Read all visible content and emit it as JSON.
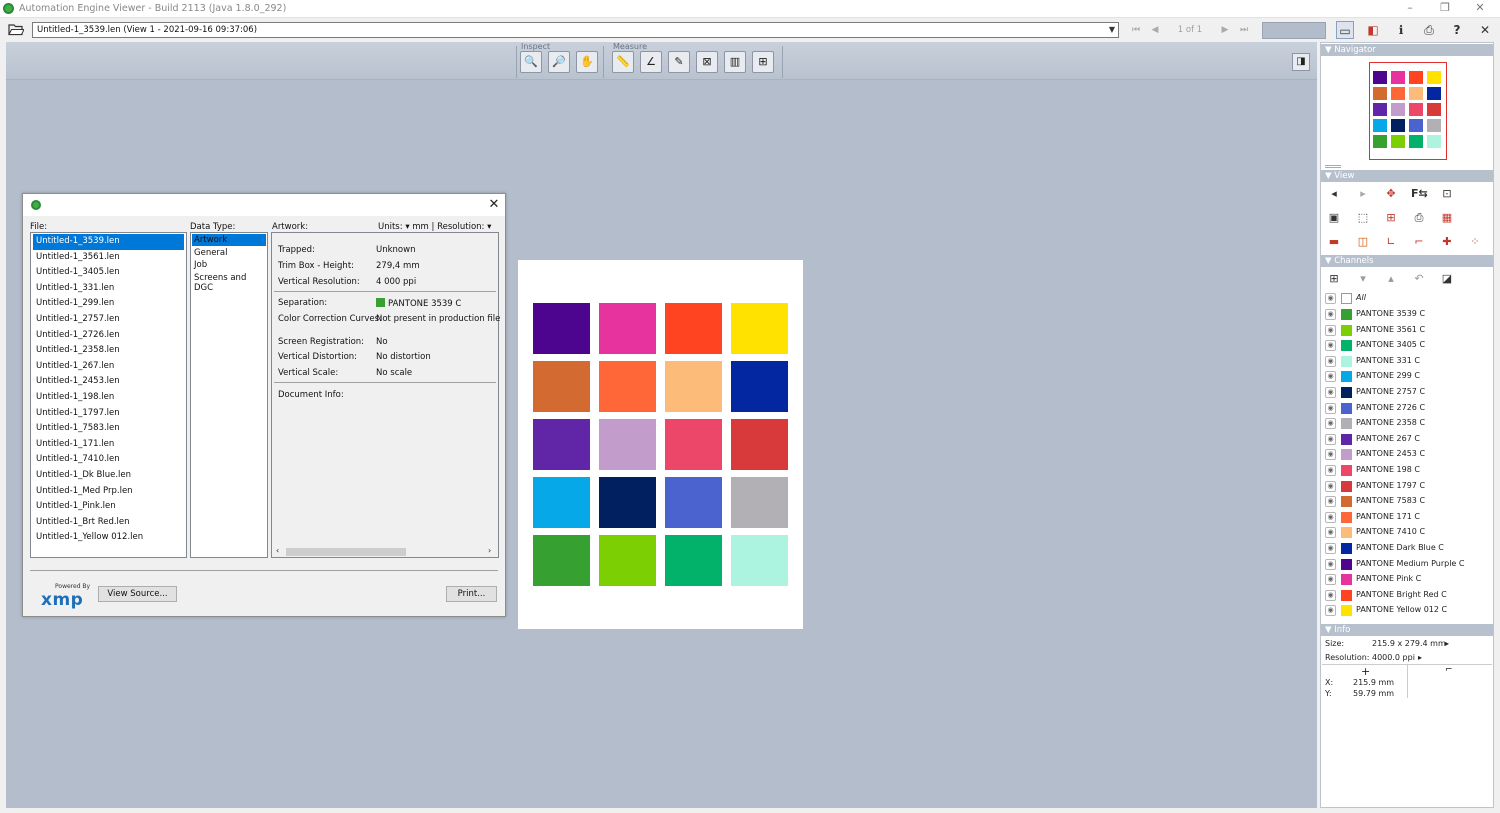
{
  "window": {
    "title": "Automation Engine Viewer - Build 2113 (Java 1.8.0_292)",
    "min": "–",
    "max": "❐",
    "close": "✕"
  },
  "toolbar": {
    "document": "Untitled-1_3539.len (View 1 - 2021-09-16 09:37:06)",
    "page_of": "1 of 1"
  },
  "ribbon": {
    "inspect_label": "Inspect",
    "measure_label": "Measure"
  },
  "dialog": {
    "file_label": "File:",
    "datatype_label": "Data Type:",
    "artwork_label": "Artwork:",
    "units_label": "Units:",
    "units_value": "mm",
    "resolution_label": "Resolution:",
    "resolution_value": "ppi",
    "files": [
      "Untitled-1_3539.len",
      "Untitled-1_3561.len",
      "Untitled-1_3405.len",
      "Untitled-1_331.len",
      "Untitled-1_299.len",
      "Untitled-1_2757.len",
      "Untitled-1_2726.len",
      "Untitled-1_2358.len",
      "Untitled-1_267.len",
      "Untitled-1_2453.len",
      "Untitled-1_198.len",
      "Untitled-1_1797.len",
      "Untitled-1_7583.len",
      "Untitled-1_171.len",
      "Untitled-1_7410.len",
      "Untitled-1_Dk Blue.len",
      "Untitled-1_Med Prp.len",
      "Untitled-1_Pink.len",
      "Untitled-1_Brt Red.len",
      "Untitled-1_Yellow 012.len"
    ],
    "datatypes": [
      "Artwork",
      "General",
      "Job",
      "Screens and DGC"
    ],
    "props": {
      "trapped_label": "Trapped:",
      "trapped": "Unknown",
      "trimbox_label": "Trim Box - Height:",
      "trimbox": "279,4 mm",
      "vres_label": "Vertical Resolution:",
      "vres": "4 000 ppi",
      "sep_label": "Separation:",
      "sep": "PANTONE 3539 C",
      "sep_color": "#3a9f35",
      "ccc_label": "Color Correction Curves:",
      "ccc": "Not present in production file",
      "screenreg_label": "Screen Registration:",
      "screenreg": "No",
      "vdist_label": "Vertical Distortion:",
      "vdist": "No distortion",
      "vscale_label": "Vertical Scale:",
      "vscale": "No scale",
      "docinfo_label": "Document Info:"
    },
    "powered_by": "Powered By",
    "xmp": "xmp",
    "view_source": "View Source...",
    "print": "Print..."
  },
  "artwork_colors": [
    [
      "#4d0590",
      "#e6339e",
      "#fe4420",
      "#ffe200"
    ],
    [
      "#d36a32",
      "#ff6638",
      "#fdbb79",
      "#0327a1"
    ],
    [
      "#6126a8",
      "#c29dcb",
      "#ec4668",
      "#d83a3c"
    ],
    [
      "#06a8e8",
      "#01205f",
      "#4a63ce",
      "#b2b0b5"
    ],
    [
      "#36a131",
      "#7bcf02",
      "#02b26b",
      "#acf3e0"
    ]
  ],
  "sidebar": {
    "navigator": "▼ Navigator",
    "view": "▼ View",
    "channels": "▼ Channels",
    "info": "▼ Info",
    "all_label": "All",
    "channels_list": [
      {
        "name": "PANTONE 3539 C",
        "color": "#36a131"
      },
      {
        "name": "PANTONE 3561 C",
        "color": "#7bcf02"
      },
      {
        "name": "PANTONE 3405 C",
        "color": "#02b26b"
      },
      {
        "name": "PANTONE 331 C",
        "color": "#acf3e0"
      },
      {
        "name": "PANTONE 299 C",
        "color": "#06a8e8"
      },
      {
        "name": "PANTONE 2757 C",
        "color": "#01205f"
      },
      {
        "name": "PANTONE 2726 C",
        "color": "#4a63ce"
      },
      {
        "name": "PANTONE 2358 C",
        "color": "#b2b0b5"
      },
      {
        "name": "PANTONE 267 C",
        "color": "#6126a8"
      },
      {
        "name": "PANTONE 2453 C",
        "color": "#c29dcb"
      },
      {
        "name": "PANTONE 198 C",
        "color": "#ec4668"
      },
      {
        "name": "PANTONE 1797 C",
        "color": "#d83a3c"
      },
      {
        "name": "PANTONE 7583 C",
        "color": "#d36a32"
      },
      {
        "name": "PANTONE 171 C",
        "color": "#ff6638"
      },
      {
        "name": "PANTONE 7410 C",
        "color": "#fdbb79"
      },
      {
        "name": "PANTONE Dark Blue C",
        "color": "#0327a1"
      },
      {
        "name": "PANTONE Medium Purple C",
        "color": "#4d0590"
      },
      {
        "name": "PANTONE Pink C",
        "color": "#e6339e"
      },
      {
        "name": "PANTONE Bright Red C",
        "color": "#fe4420"
      },
      {
        "name": "PANTONE Yellow 012 C",
        "color": "#ffe200"
      }
    ],
    "size_label": "Size:",
    "size_value": "215.9 x 279.4 mm",
    "res_label": "Resolution:",
    "res_value": "4000.0 ppi",
    "x_label": "X:",
    "x_value": "215.9 mm",
    "y_label": "Y:",
    "y_value": "59.79 mm"
  }
}
